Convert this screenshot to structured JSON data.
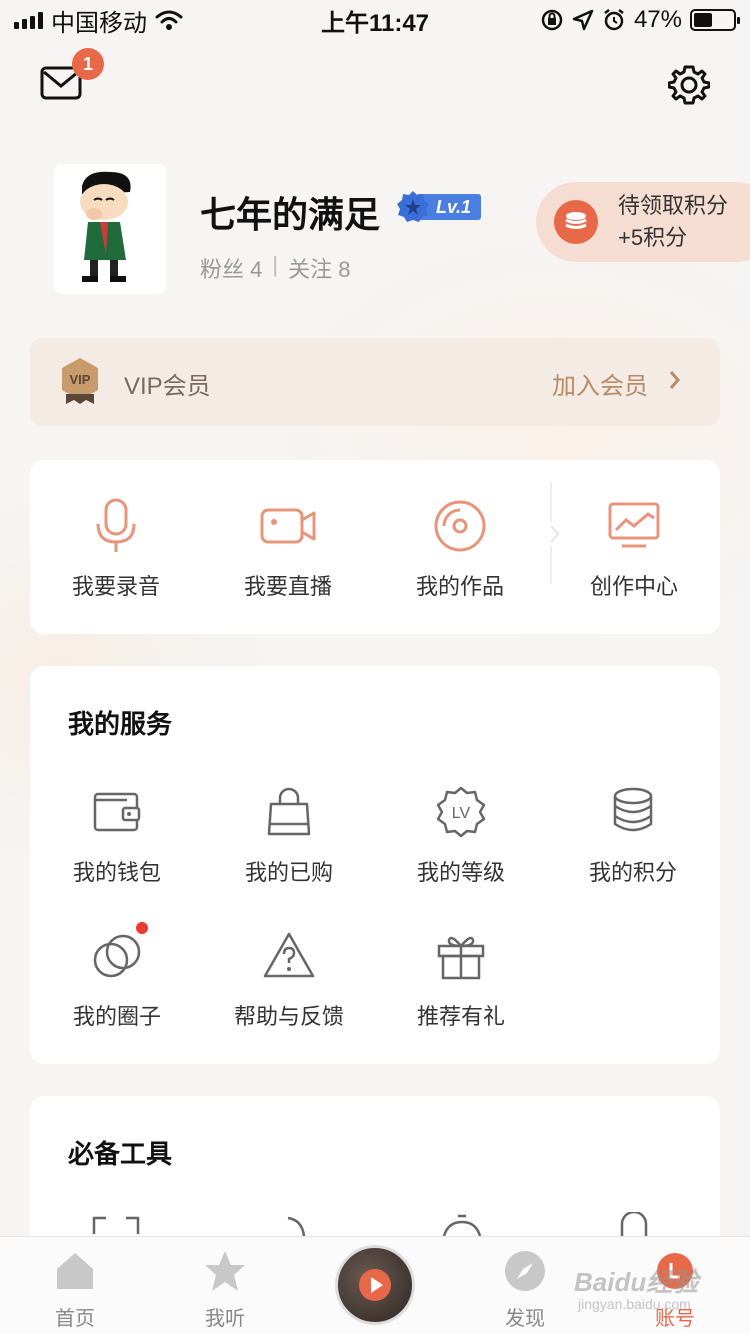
{
  "status_bar": {
    "carrier": "中国移动",
    "time": "上午11:47",
    "battery": "47%",
    "battery_level": 0.47
  },
  "header": {
    "mail_badge": "1",
    "mail_icon": "mail-icon",
    "settings_icon": "gear-icon"
  },
  "profile": {
    "nickname": "七年的满足",
    "level": "Lv.1",
    "fans_label": "粉丝 4",
    "separator": "|",
    "following_label": "关注 8",
    "points_title": "待领取积分",
    "points_value": "+5积分"
  },
  "vip": {
    "badge_text": "VIP",
    "label": "VIP会员",
    "join": "加入会员"
  },
  "actions": [
    {
      "label": "我要录音",
      "icon": "microphone-icon"
    },
    {
      "label": "我要直播",
      "icon": "video-camera-icon"
    },
    {
      "label": "我的作品",
      "icon": "disc-icon"
    },
    {
      "label": "创作中心",
      "icon": "monitor-chart-icon"
    }
  ],
  "services": {
    "title": "我的服务",
    "items": [
      {
        "label": "我的钱包",
        "icon": "wallet-icon"
      },
      {
        "label": "我的已购",
        "icon": "shopping-bag-icon"
      },
      {
        "label": "我的等级",
        "icon": "level-badge-icon",
        "icon_text": "LV"
      },
      {
        "label": "我的积分",
        "icon": "coins-icon"
      },
      {
        "label": "我的圈子",
        "icon": "circles-icon"
      },
      {
        "label": "帮助与反馈",
        "icon": "help-triangle-icon"
      },
      {
        "label": "推荐有礼",
        "icon": "gift-icon"
      }
    ]
  },
  "tools": {
    "title": "必备工具"
  },
  "tab_bar": {
    "items": [
      {
        "label": "首页",
        "icon": "home-icon"
      },
      {
        "label": "我听",
        "icon": "star-icon"
      },
      {
        "label": "发现",
        "icon": "compass-icon"
      },
      {
        "label": "账号",
        "icon": "account-icon",
        "active": true
      }
    ],
    "accent": "#e8694a"
  },
  "watermark": {
    "text": "Baidu经验",
    "sub": "jingyan.baidu.com"
  }
}
